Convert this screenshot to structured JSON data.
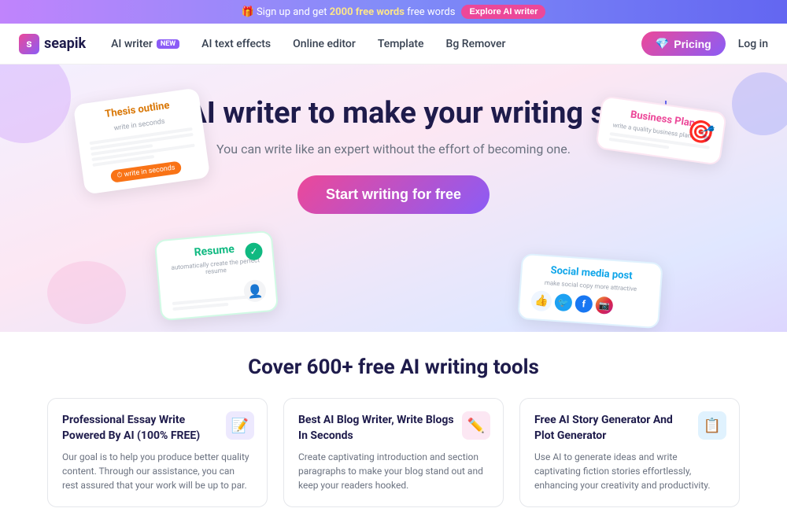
{
  "banner": {
    "prefix": "🎁 Sign up and get ",
    "highlight": "2000 free words",
    "suffix": "",
    "explore_label": "Explore AI writer"
  },
  "navbar": {
    "logo_text": "seapik",
    "links": [
      {
        "id": "ai-writer",
        "label": "AI writer",
        "badge": "NEW"
      },
      {
        "id": "ai-text-effects",
        "label": "AI text effects",
        "badge": null
      },
      {
        "id": "online-editor",
        "label": "Online editor",
        "badge": null
      },
      {
        "id": "template",
        "label": "Template",
        "badge": null
      },
      {
        "id": "bg-remover",
        "label": "Bg Remover",
        "badge": null
      }
    ],
    "pricing_label": "Pricing",
    "login_label": "Log in"
  },
  "hero": {
    "title": "Free AI writer to make your writing shine",
    "subtitle": "You can write like an expert without the effort of becoming one.",
    "cta_label": "Start writing for free",
    "card_thesis_title": "Thesis outline",
    "card_thesis_body": "write in seconds",
    "card_business_title": "Business Plan",
    "card_business_sub": "write a quality business plan faster",
    "card_resume_title": "Resume",
    "card_resume_sub": "automatically create the perfect resume",
    "card_social_title": "Social media post",
    "card_social_sub": "make social copy more attractive"
  },
  "tools": {
    "section_title": "Cover 600+ free AI writing tools",
    "cards": [
      {
        "id": "essay",
        "title": "Professional Essay Write Powered By AI (100% FREE)",
        "desc": "Our goal is to help you produce better quality content. Through our assistance, you can rest assured that your work will be up to par.",
        "icon": "📝",
        "icon_style": "purple"
      },
      {
        "id": "blog",
        "title": "Best AI Blog Writer, Write Blogs In Seconds",
        "desc": "Create captivating introduction and section paragraphs to make your blog stand out and keep your readers hooked.",
        "icon": "✏️",
        "icon_style": "pink"
      },
      {
        "id": "story",
        "title": "Free AI Story Generator And Plot Generator",
        "desc": "Use AI to generate ideas and write captivating fiction stories effortlessly, enhancing your creativity and productivity.",
        "icon": "📋",
        "icon_style": "blue"
      }
    ]
  }
}
